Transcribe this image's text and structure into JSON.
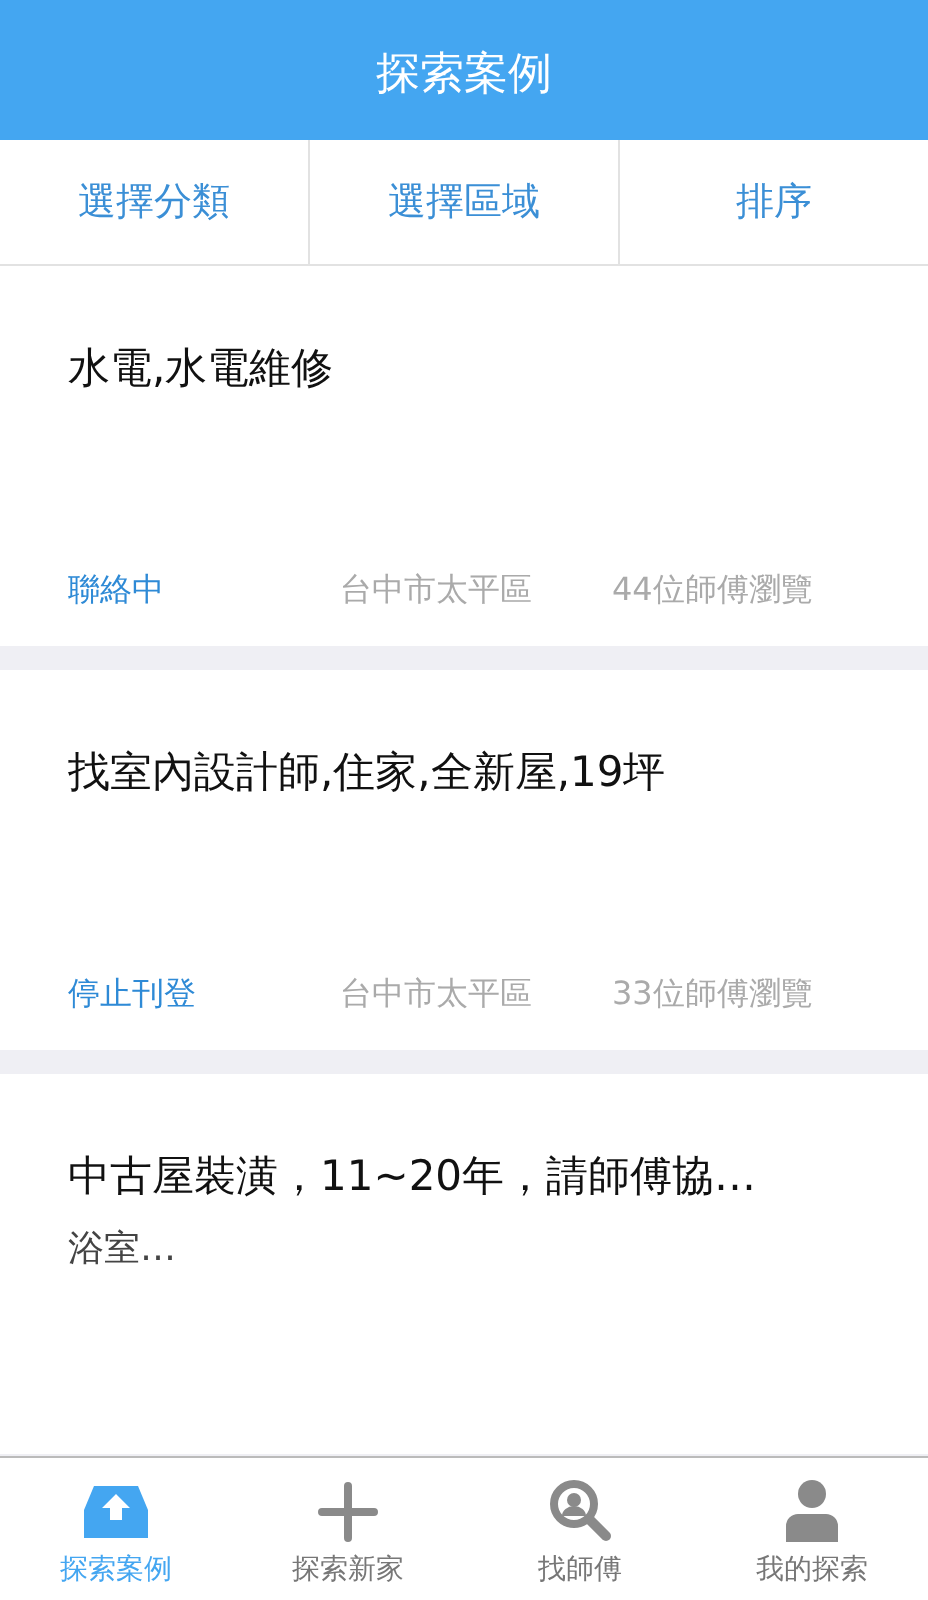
{
  "header": {
    "title": "探索案例"
  },
  "filters": [
    "選擇分類",
    "選擇區域",
    "排序"
  ],
  "cases": [
    {
      "title": "水電,水電維修",
      "status": "聯絡中",
      "location": "台中市太平區",
      "views": "44位師傅瀏覽"
    },
    {
      "title": "找室內設計師,住家,全新屋,19坪",
      "status": "停止刊登",
      "location": "台中市太平區",
      "views": "33位師傅瀏覽"
    },
    {
      "title": "中古屋裝潢，11~20年，請師傅協…",
      "subtitle": "浴室…"
    }
  ],
  "tab_bar": [
    {
      "label": "探索案例",
      "selected": true
    },
    {
      "label": "探索新家",
      "selected": false
    },
    {
      "label": "找師傅",
      "selected": false
    },
    {
      "label": "我的探索",
      "selected": false
    }
  ]
}
